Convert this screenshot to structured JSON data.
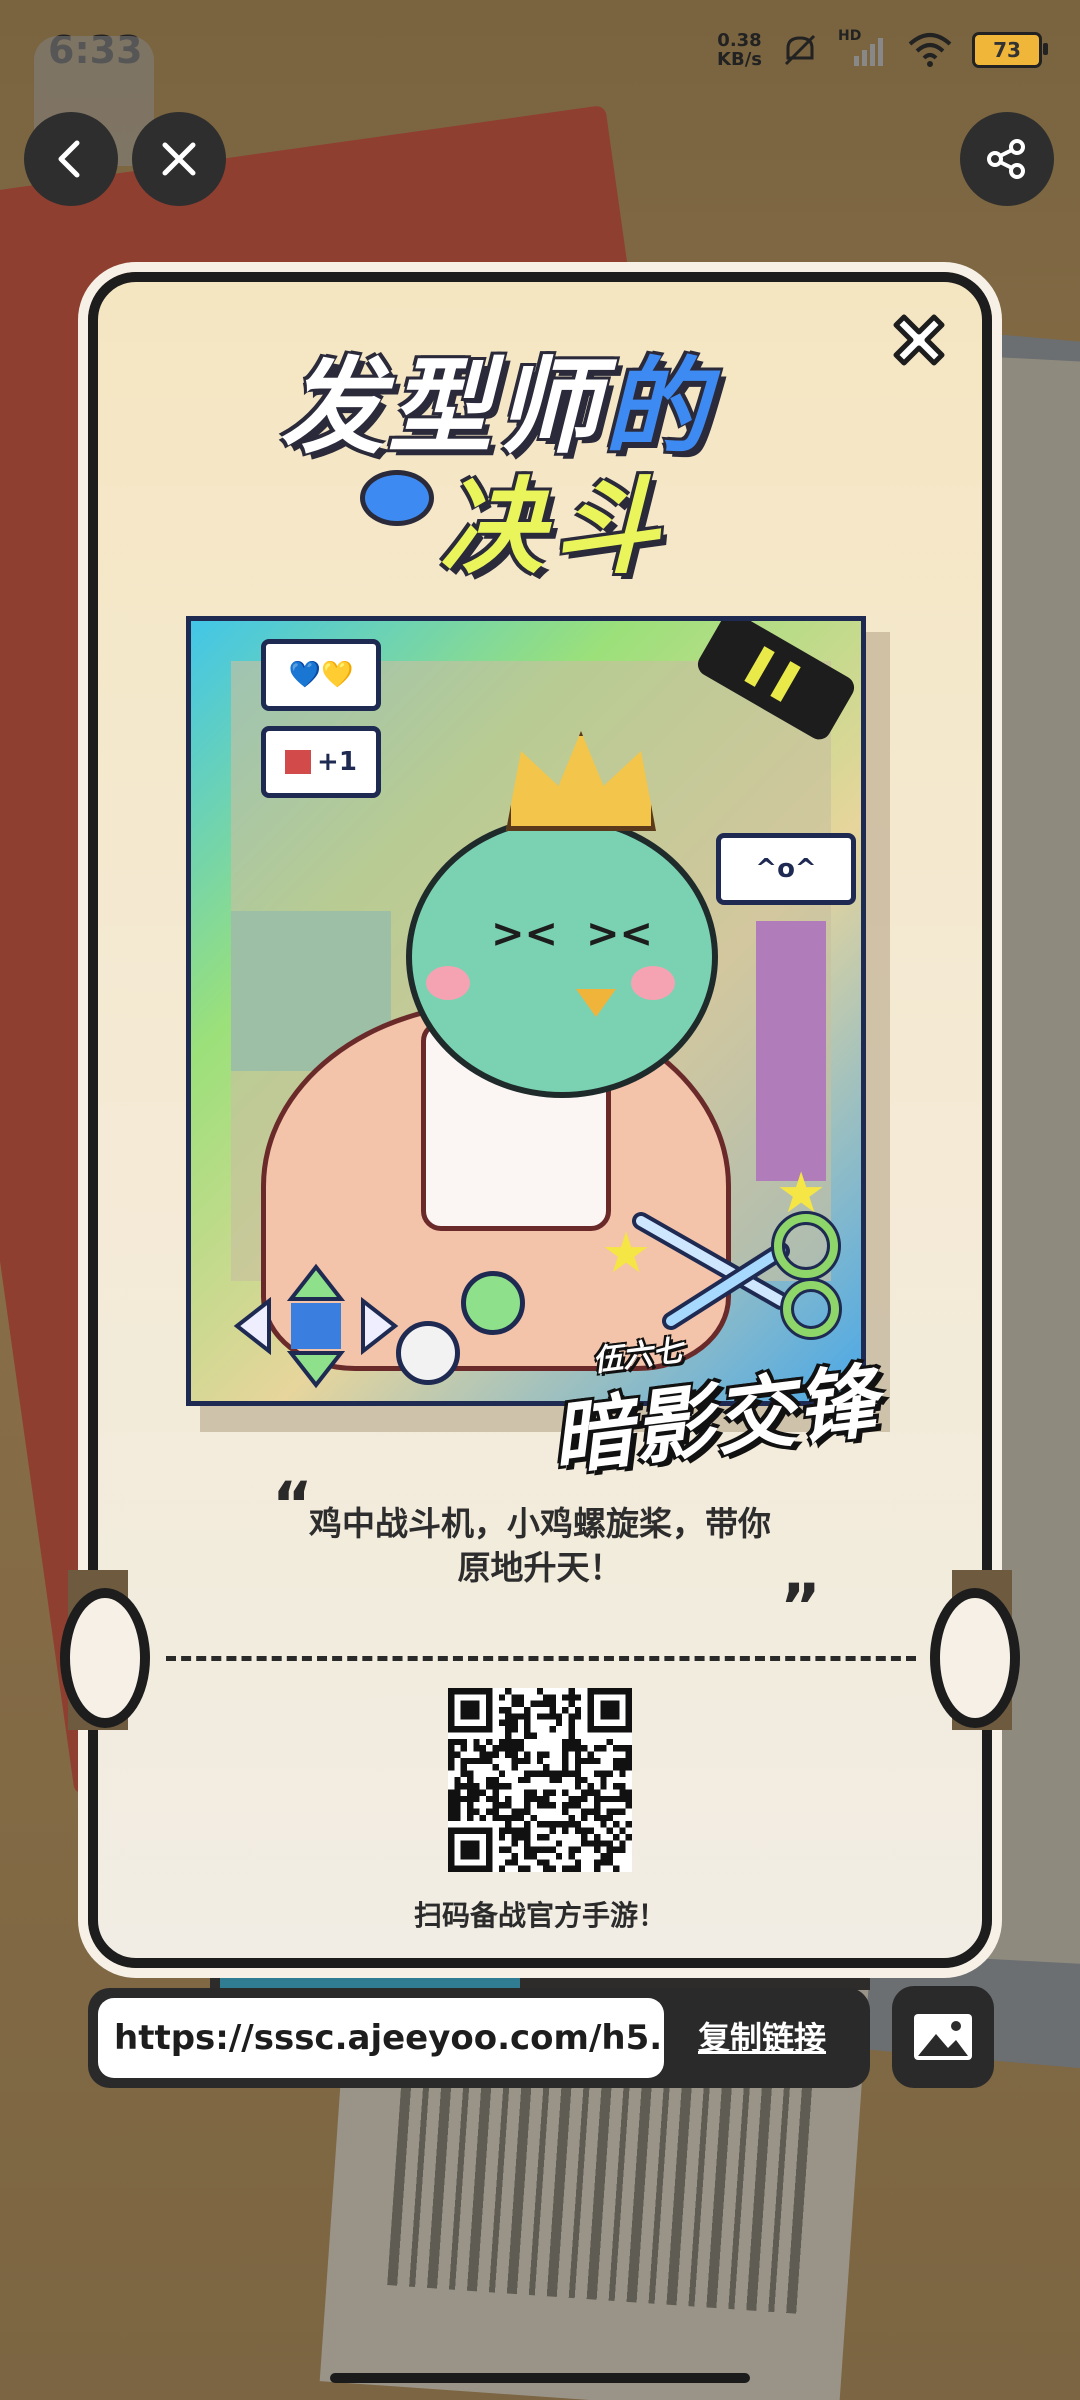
{
  "status_bar": {
    "time": "6:33",
    "net_speed_value": "0.38",
    "net_speed_unit": "KB/s",
    "network_label": "HD",
    "battery_level": "73"
  },
  "nav": {
    "back_icon": "chevron-left-icon",
    "close_icon": "close-icon",
    "share_icon": "share-icon"
  },
  "card": {
    "title_part1": "发型",
    "title_part2": "师",
    "title_part3": "的",
    "title_line2": "决斗",
    "artwork": {
      "bubble_heart": "💙💛",
      "bubble_like": "+1",
      "bubble_face": "^o^"
    },
    "logo_small": "伍六七",
    "logo_main": "暗影交锋",
    "quote_open_mark": "“",
    "quote_text": "鸡中战斗机，小鸡螺旋桨，带你原地升天！",
    "quote_close_mark": "”",
    "qr_caption": "扫码备战官方手游！"
  },
  "share_bar": {
    "link_text": "https://sssc.ajeeyoo.com/h5...",
    "copy_label": "复制链接",
    "save_image_icon": "image-icon"
  },
  "colors": {
    "card_border": "#1d1d1d",
    "accent_blue": "#3d8bf2",
    "accent_yellow": "#e9f55a"
  }
}
